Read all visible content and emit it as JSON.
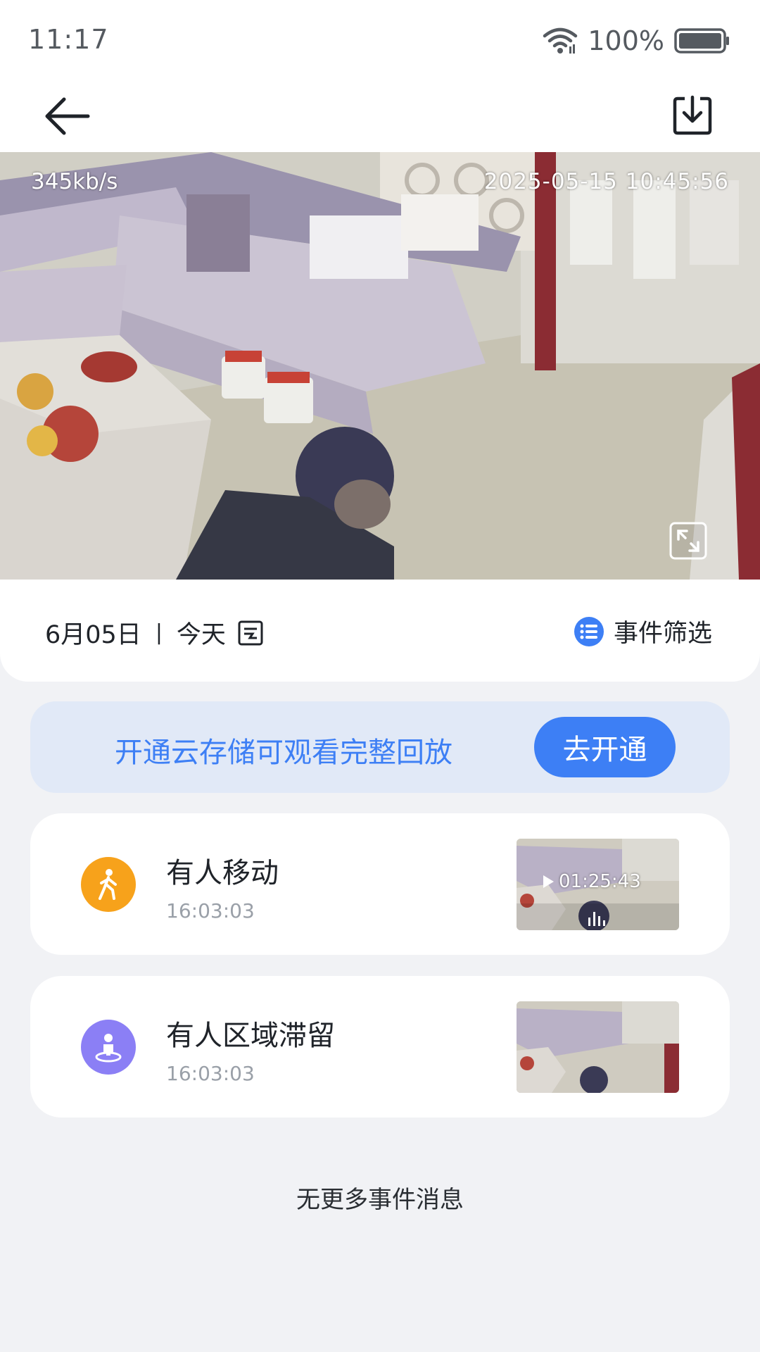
{
  "status_bar": {
    "time": "11:17",
    "battery_percent": "100%",
    "icons": [
      "wifi-icon",
      "battery-icon"
    ]
  },
  "nav": {
    "icons": [
      "back-arrow-icon",
      "download-icon"
    ]
  },
  "video": {
    "bitrate": "345kb/s",
    "timestamp": "2025-05-15  10:45:56",
    "icons": [
      "fullscreen-icon"
    ]
  },
  "date_bar": {
    "date": "6月05日",
    "separator": "|",
    "day_label": "今天",
    "filter_label": "事件筛选",
    "icons": [
      "calendar-icon",
      "list-filter-icon"
    ]
  },
  "cloud_banner": {
    "message": "开通云存储可观看完整回放",
    "button_label": "去开通"
  },
  "events": [
    {
      "title": "有人移动",
      "time": "16:03:03",
      "icon": "walking-person-icon",
      "icon_color": "#f7a21b",
      "thumbnail_duration": "01:25:43"
    },
    {
      "title": "有人区域滞留",
      "time": "16:03:03",
      "icon": "person-in-zone-icon",
      "icon_color": "#8b7ff5"
    }
  ],
  "footer": {
    "no_more_text": "无更多事件消息"
  },
  "colors": {
    "accent": "#3d7ff5",
    "banner_bg": "#e1e9f7",
    "page_bg": "#f1f2f5"
  }
}
